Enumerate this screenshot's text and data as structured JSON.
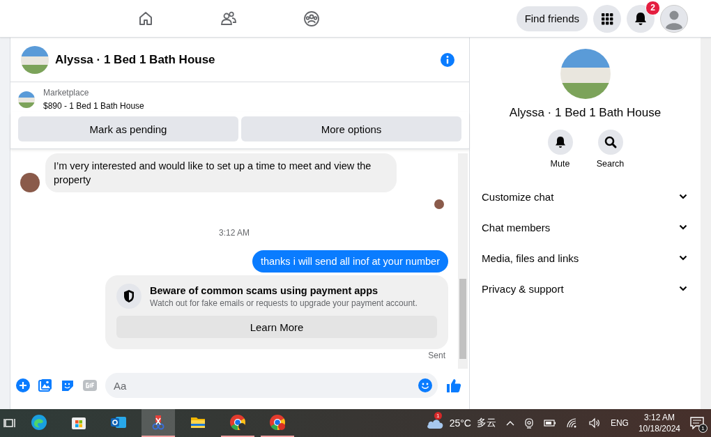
{
  "nav": {
    "find_friends": "Find friends",
    "notification_count": "2"
  },
  "chat": {
    "title": "Alyssa · 1 Bed 1 Bath House",
    "listing": {
      "source": "Marketplace",
      "title": "$890 - 1 Bed 1 Bath House"
    },
    "actions": [
      "Mark as pending",
      "More options"
    ],
    "messages": [
      {
        "kind": "received",
        "text": "I’m very interested and would like to set up a time to meet and view the property"
      },
      {
        "kind": "seen"
      },
      {
        "kind": "timestamp",
        "text": "3:12 AM"
      },
      {
        "kind": "sent",
        "text": "thanks i will send all inof at your number"
      },
      {
        "kind": "notice",
        "title": "Beware of common scams using payment apps",
        "body": "Watch out for fake emails or requests to upgrade your payment account.",
        "button": "Learn More"
      },
      {
        "kind": "status",
        "text": "Sent"
      }
    ],
    "composer": {
      "placeholder": "Aa"
    }
  },
  "details": {
    "name": "Alyssa · 1 Bed 1 Bath House",
    "actions": [
      {
        "kind": "mute",
        "label": "Mute"
      },
      {
        "kind": "search",
        "label": "Search"
      }
    ],
    "sections": [
      "Customize chat",
      "Chat members",
      "Media, files and links",
      "Privacy & support"
    ]
  },
  "taskbar": {
    "apps": [
      {
        "kind": "edge",
        "selected": false,
        "running": false
      },
      {
        "kind": "store",
        "selected": false,
        "running": false
      },
      {
        "kind": "outlook",
        "selected": false,
        "running": false
      },
      {
        "kind": "snipping",
        "selected": true,
        "running": true
      },
      {
        "kind": "explorer",
        "selected": false,
        "running": false
      },
      {
        "kind": "chrome",
        "selected": false,
        "running": true
      },
      {
        "kind": "chrome-profile",
        "selected": false,
        "running": true
      }
    ],
    "weather": {
      "badge": "1",
      "temperature": "25°C",
      "condition": "多云"
    },
    "language": "ENG",
    "time": "3:12 AM",
    "date": "10/18/2024",
    "notification_count": "1"
  }
}
